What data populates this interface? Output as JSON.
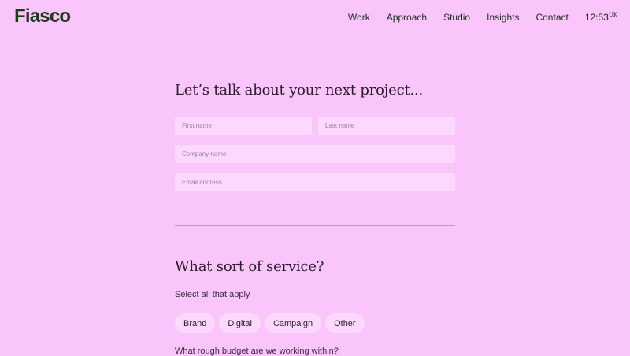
{
  "header": {
    "logo": "Fiasco",
    "nav": [
      "Work",
      "Approach",
      "Studio",
      "Insights",
      "Contact"
    ],
    "time": "12:53",
    "time_zone": "UK"
  },
  "contact": {
    "heading": "Let’s talk about your next project...",
    "first_name_placeholder": "First name",
    "last_name_placeholder": "Last name",
    "company_placeholder": "Company name",
    "email_placeholder": "Email address"
  },
  "services": {
    "heading": "What sort of service?",
    "hint": "Select all that apply",
    "options": [
      "Brand",
      "Digital",
      "Campaign",
      "Other"
    ]
  },
  "budget": {
    "question": "What rough budget are we working within?"
  },
  "colors": {
    "background": "#f9c5fb",
    "field": "#fbd8fc",
    "logo": "#1d3a1d"
  }
}
